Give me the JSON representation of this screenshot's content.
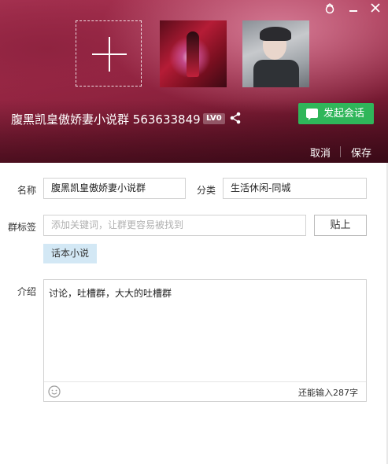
{
  "header": {
    "group_title": "腹黑凯皇傲娇妻小说群 563633849",
    "level_badge": "LV0",
    "start_chat_label": "发起会话",
    "cancel_label": "取消",
    "save_label": "保存",
    "icons": {
      "skin": "skin-icon",
      "minimize": "minimize-icon",
      "close": "close-icon",
      "add_photo": "plus-icon",
      "share": "share-icon",
      "chat": "chat-bubble-icon"
    }
  },
  "form": {
    "name_label": "名称",
    "name_value": "腹黑凯皇傲娇妻小说群",
    "category_label": "分类",
    "category_value": "生活休闲-同城",
    "tags_label": "群标签",
    "tags_placeholder": "添加关键词，让群更容易被找到",
    "paste_label": "贴上",
    "tags": [
      "话本小说"
    ],
    "intro_label": "介绍",
    "intro_value": "讨论，吐槽群，大大的吐槽群",
    "char_remaining": "还能输入287字"
  },
  "colors": {
    "accent_green": "#2fb65a",
    "tag_bg": "#d3e8f5",
    "header_red": "#a02a48"
  }
}
